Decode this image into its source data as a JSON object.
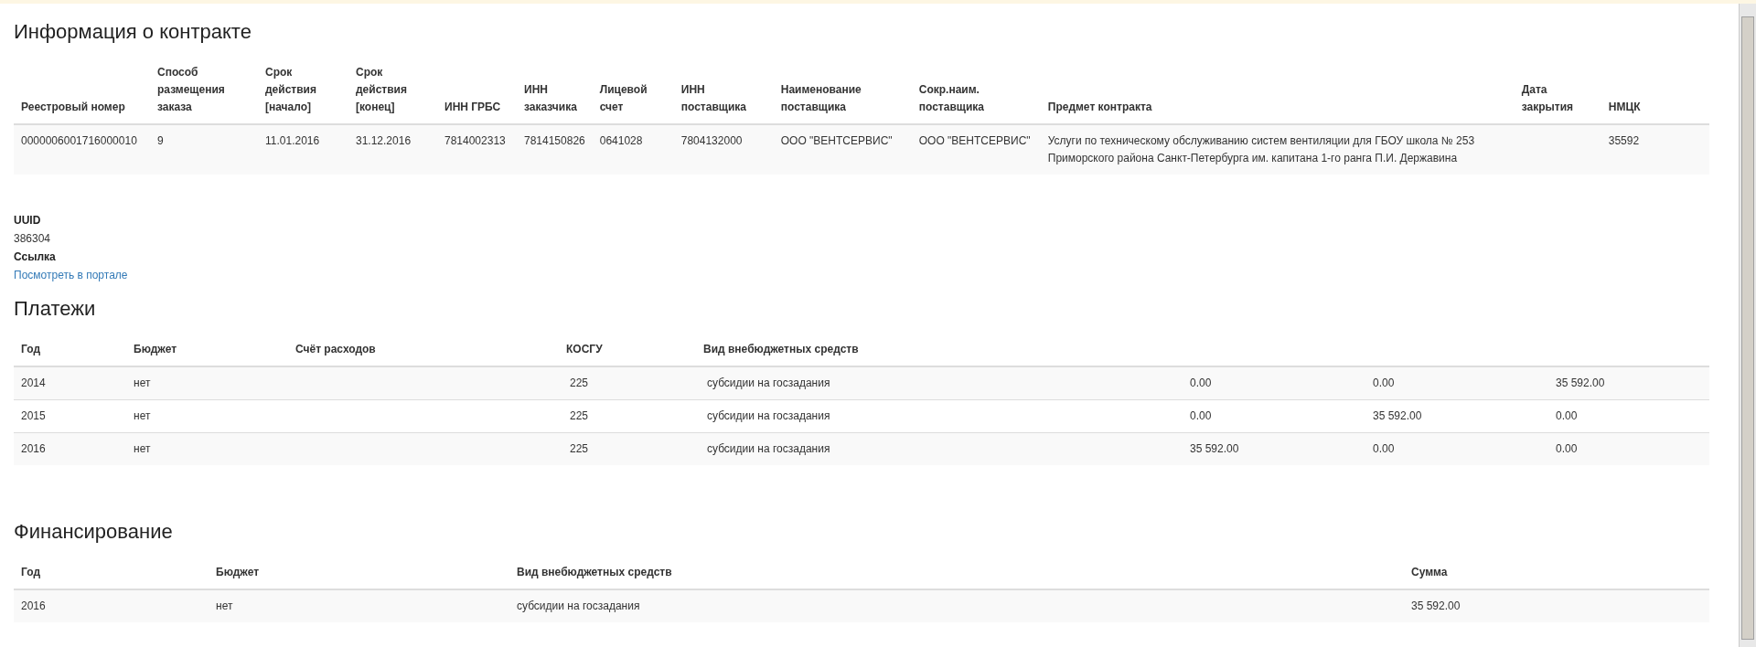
{
  "contract": {
    "title": "Информация о контракте",
    "columns": [
      "Реестровый номер",
      "Способ размещения заказа",
      "Срок действия [начало]",
      "Срок действия [конец]",
      "ИНН ГРБС",
      "ИНН заказчика",
      "Лицевой счет",
      "ИНН поставщика",
      "Наименование поставщика",
      "Сокр.наим. поставщика",
      "Предмет контракта",
      "Дата закрытия",
      "НМЦК"
    ],
    "rows": [
      [
        "0000006001716000010",
        "9",
        "11.01.2016",
        "31.12.2016",
        "7814002313",
        "7814150826",
        "0641028",
        "7804132000",
        "ООО \"ВЕНТСЕРВИС\"",
        "ООО \"ВЕНТСЕРВИС\"",
        "Услуги по техническому обслуживанию систем вентиляции для ГБОУ школа № 253 Приморского района Санкт-Петербурга им. капитана 1-го ранга П.И. Державина",
        "",
        "35592"
      ]
    ]
  },
  "details": [
    {
      "label": "UUID",
      "value": "386304",
      "kind": "text"
    },
    {
      "label": "Ссылка",
      "value": "Посмотреть в портале",
      "kind": "link"
    }
  ],
  "payments": {
    "title": "Платежи",
    "columns": [
      "Год",
      "Бюджет",
      "Счёт расходов",
      "КОСГУ",
      "Вид внебюджетных средств"
    ],
    "rows": [
      [
        "2014",
        "нет",
        "",
        "225",
        "субсидии на госзадания",
        "0.00",
        "0.00",
        "35 592.00"
      ],
      [
        "2015",
        "нет",
        "",
        "225",
        "субсидии на госзадания",
        "0.00",
        "35 592.00",
        "0.00"
      ],
      [
        "2016",
        "нет",
        "",
        "225",
        "субсидии на госзадания",
        "35 592.00",
        "0.00",
        "0.00"
      ]
    ]
  },
  "financing": {
    "title": "Финансирование",
    "columns": [
      "Год",
      "Бюджет",
      "Вид внебюджетных средств",
      "Сумма"
    ],
    "rows": [
      [
        "2016",
        "нет",
        "субсидии на госзадания",
        "35 592.00"
      ]
    ]
  }
}
